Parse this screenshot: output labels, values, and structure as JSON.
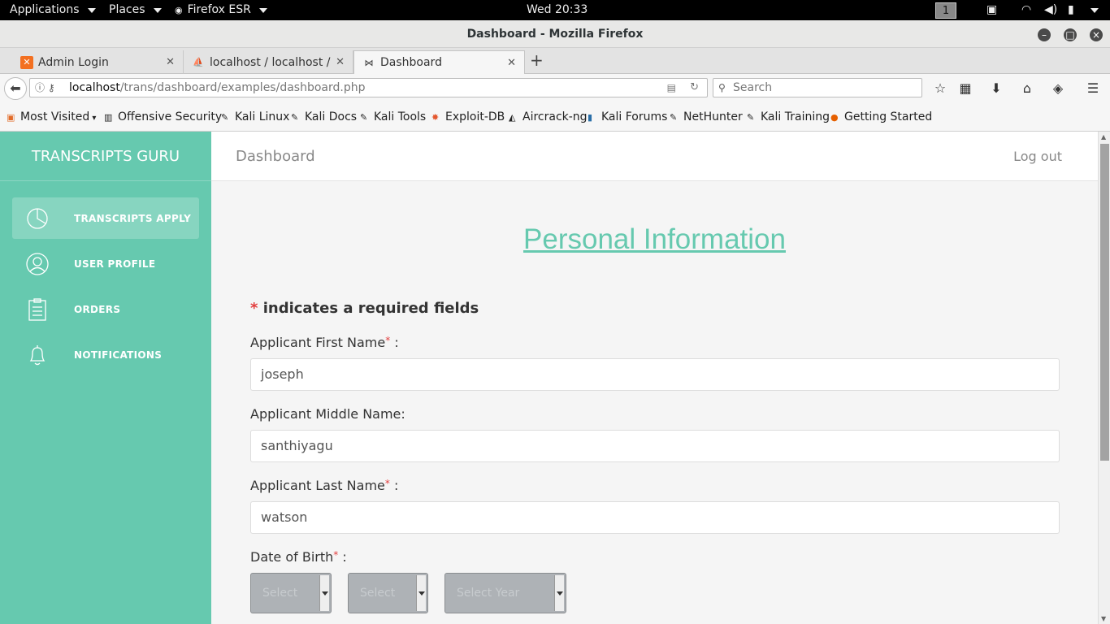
{
  "system_bar": {
    "applications": "Applications",
    "places": "Places",
    "firefox": "Firefox ESR",
    "clock": "Wed 20:33",
    "workspace": "1"
  },
  "window": {
    "title": "Dashboard - Mozilla Firefox"
  },
  "tabs": [
    {
      "label": "Admin Login",
      "favicon": "xampp-icon"
    },
    {
      "label": "localhost / localhost /...",
      "favicon": "phpmyadmin-icon"
    },
    {
      "label": "Dashboard",
      "favicon": "bow-icon"
    }
  ],
  "nav": {
    "url_host": "localhost",
    "url_path": "/trans/dashboard/examples/dashboard.php",
    "search_placeholder": "Search"
  },
  "bookmarks": [
    "Most Visited",
    "Offensive Security",
    "Kali Linux",
    "Kali Docs",
    "Kali Tools",
    "Exploit-DB",
    "Aircrack-ng",
    "Kali Forums",
    "NetHunter",
    "Kali Training",
    "Getting Started"
  ],
  "sidebar": {
    "brand": "TRANSCRIPTS GURU",
    "items": [
      {
        "label": "TRANSCRIPTS APPLY",
        "icon": "pie-chart-icon"
      },
      {
        "label": "USER PROFILE",
        "icon": "user-icon"
      },
      {
        "label": "ORDERS",
        "icon": "clipboard-icon"
      },
      {
        "label": "NOTIFICATIONS",
        "icon": "bell-icon"
      }
    ]
  },
  "topnav": {
    "title": "Dashboard",
    "logout": "Log out"
  },
  "form": {
    "heading": "Personal Information",
    "required_note": "indicates a required fields",
    "first_name_label": "Applicant First Name",
    "first_name_value": "joseph",
    "middle_name_label": "Applicant Middle Name:",
    "middle_name_value": "santhiyagu",
    "last_name_label": "Applicant Last Name",
    "last_name_value": "watson",
    "dob_label": "Date of Birth",
    "dob_day": "Select",
    "dob_month": "Select",
    "dob_year": "Select Year",
    "colon": ":",
    "star": "*"
  },
  "colors": {
    "accent": "#66c9af",
    "required": "#e23d3d"
  }
}
